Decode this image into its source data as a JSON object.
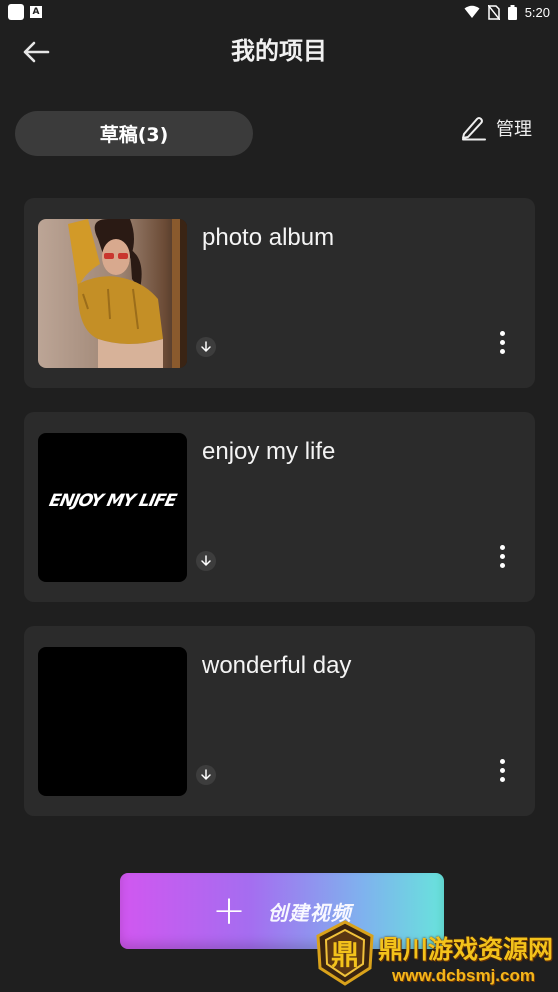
{
  "status_bar": {
    "notif_badge": "A",
    "time": "5:20"
  },
  "header": {
    "title": "我的项目"
  },
  "tabs": {
    "draft_label": "草稿(3)",
    "manage_label": "管理"
  },
  "projects": [
    {
      "title": "photo album",
      "thumb": "photo"
    },
    {
      "title": "enjoy my life",
      "thumb": "text",
      "thumb_text": "ENJOY MY LIFE"
    },
    {
      "title": "wonderful day",
      "thumb": "black"
    }
  ],
  "create_button": {
    "label": "创建视频"
  },
  "watermark": {
    "badge_text": "鼎",
    "name": "鼎川游戏资源网",
    "url": "www.dcbsmj.com"
  },
  "colors": {
    "background": "#1f1f1f",
    "card": "#2b2b2b",
    "tab": "#3b3b3b",
    "accent_start": "#d157f0",
    "accent_end": "#68e3dc"
  }
}
